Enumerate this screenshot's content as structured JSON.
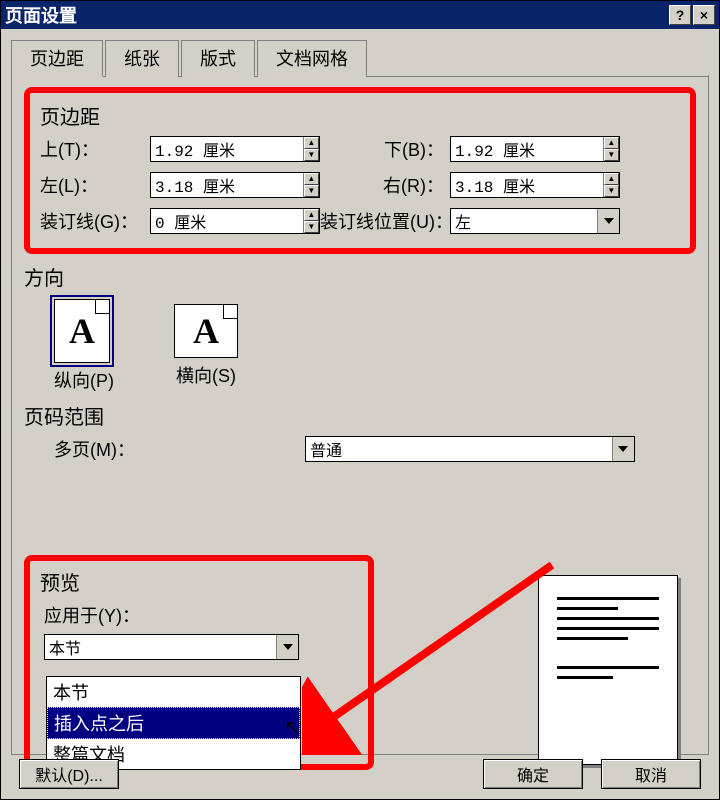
{
  "title": "页面设置",
  "tabs": [
    "页边距",
    "纸张",
    "版式",
    "文档网格"
  ],
  "active_tab": 0,
  "margins": {
    "group_label": "页边距",
    "top_label": "上(T)：",
    "top_value": "1.92 厘米",
    "bottom_label": "下(B)：",
    "bottom_value": "1.92 厘米",
    "left_label": "左(L)：",
    "left_value": "3.18 厘米",
    "right_label": "右(R)：",
    "right_value": "3.18 厘米",
    "gutter_label": "装订线(G)：",
    "gutter_value": "0 厘米",
    "gutter_pos_label": "装订线位置(U)：",
    "gutter_pos_value": "左"
  },
  "orientation": {
    "section_label": "方向",
    "portrait_label": "纵向(P)",
    "landscape_label": "横向(S)",
    "active": "portrait"
  },
  "page_range": {
    "section_label": "页码范围",
    "multi_label": "多页(M)：",
    "multi_value": "普通"
  },
  "preview": {
    "group_label": "预览",
    "apply_label": "应用于(Y)：",
    "apply_value": "本节",
    "options": [
      "本节",
      "插入点之后",
      "整篇文档"
    ],
    "highlighted_index": 1
  },
  "buttons": {
    "default": "默认(D)...",
    "ok": "确定",
    "cancel": "取消"
  }
}
